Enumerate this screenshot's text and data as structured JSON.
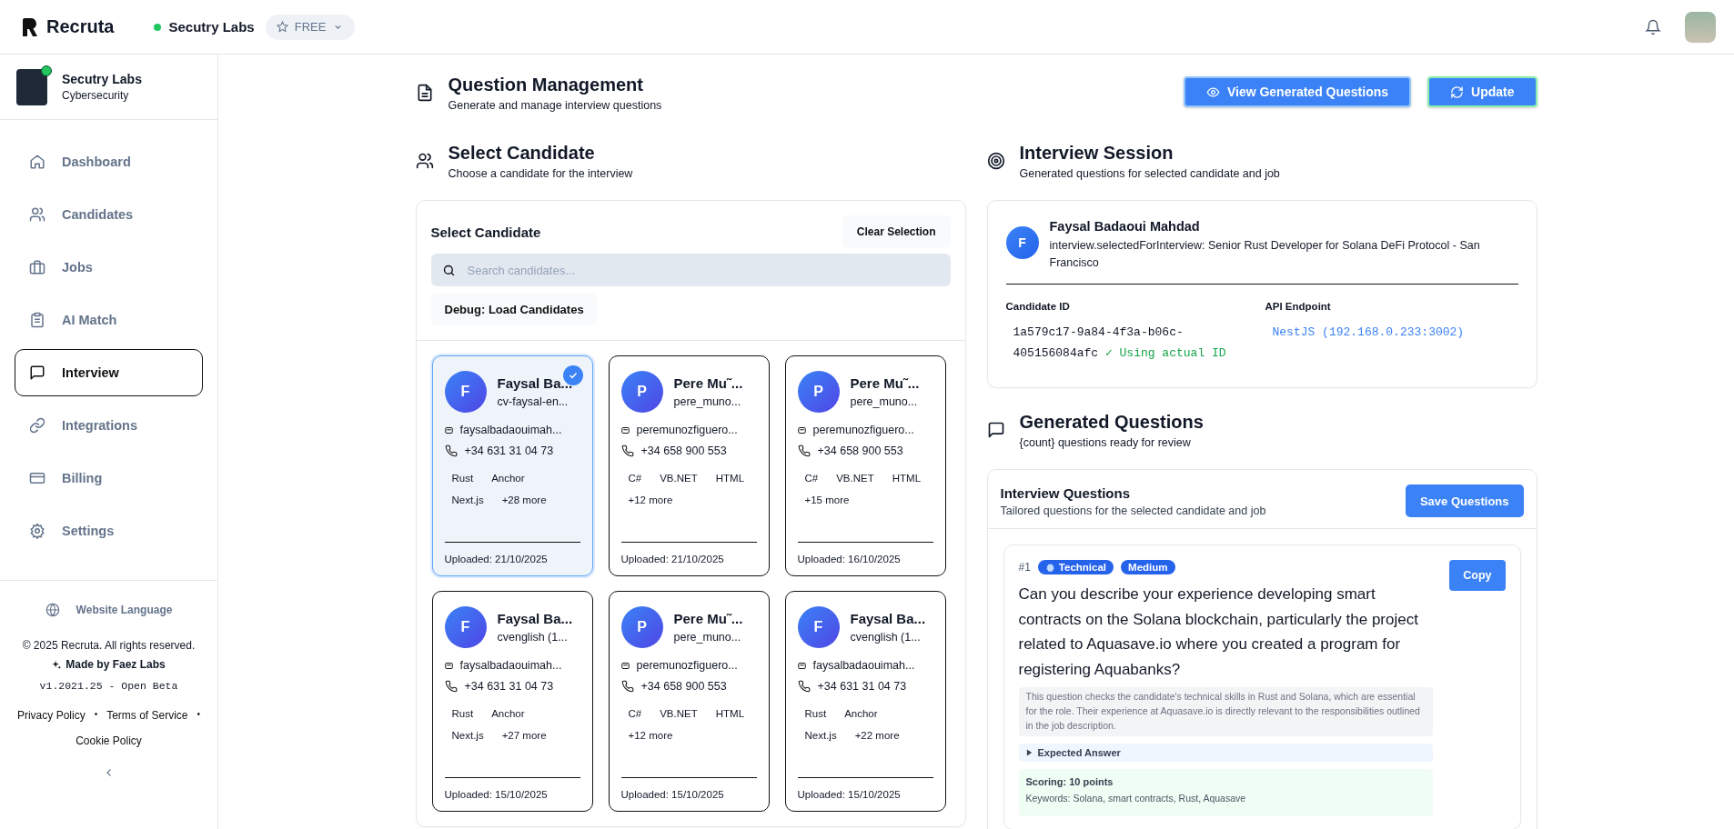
{
  "brand": {
    "name": "Recruta"
  },
  "workspace": {
    "name": "Secutry Labs",
    "online": true
  },
  "plan": {
    "label": "FREE"
  },
  "sidebar": {
    "profile": {
      "name": "Secutry Labs",
      "subtitle": "Cybersecurity",
      "online": true
    },
    "items": [
      {
        "label": "Dashboard",
        "selected": false
      },
      {
        "label": "Candidates",
        "selected": false
      },
      {
        "label": "Jobs",
        "selected": false
      },
      {
        "label": "AI Match",
        "selected": false
      },
      {
        "label": "Interview",
        "selected": true
      },
      {
        "label": "Integrations",
        "selected": false
      },
      {
        "label": "Billing",
        "selected": false
      },
      {
        "label": "Settings",
        "selected": false
      }
    ],
    "footer": {
      "language": "Website Language",
      "copyright": "© 2025 Recruta. All rights reserved.",
      "made_by": "Made by Faez Labs",
      "version": "v1.2021.25 - Open Beta",
      "links": [
        "Privacy Policy",
        "Terms of Service",
        "Cookie Policy"
      ],
      "separators": [
        "•",
        "•"
      ]
    }
  },
  "page": {
    "title": "Question Management",
    "subtitle": "Generate and manage interview questions",
    "buttons": [
      "View Generated Questions",
      "Update"
    ]
  },
  "candidate_section": {
    "title": "Select Candidate",
    "subtitle": "Choose a candidate for the interview",
    "card_title": "Select Candidate",
    "clear_button": "Clear Selection",
    "search": {
      "placeholder": "Search candidates..."
    },
    "debug_button": "Debug: Load Candidates",
    "candidates": [
      {
        "initial": "F",
        "name": "Faysal Ba...",
        "file": "cv-faysal-en...",
        "email": "faysalbadaouimah...",
        "phone": "+34 631 31 04 73",
        "skills": [
          "Rust",
          "Anchor",
          "Next.js",
          "+28 more"
        ],
        "uploaded": "Uploaded: 21/10/2025",
        "selected": true
      },
      {
        "initial": "P",
        "name": "Pere Mu˜...",
        "file": "pere_muno...",
        "email": "peremunozfiguero...",
        "phone": "+34 658 900 553",
        "skills": [
          "C#",
          "VB.NET",
          "HTML",
          "+12 more"
        ],
        "uploaded": "Uploaded: 21/10/2025",
        "selected": false
      },
      {
        "initial": "P",
        "name": "Pere Mu˜...",
        "file": "pere_muno...",
        "email": "peremunozfiguero...",
        "phone": "+34 658 900 553",
        "skills": [
          "C#",
          "VB.NET",
          "HTML",
          "+15 more"
        ],
        "uploaded": "Uploaded: 16/10/2025",
        "selected": false
      },
      {
        "initial": "F",
        "name": "Faysal Ba...",
        "file": "cvenglish (1...",
        "email": "faysalbadaouimah...",
        "phone": "+34 631 31 04 73",
        "skills": [
          "Rust",
          "Anchor",
          "Next.js",
          "+27 more"
        ],
        "uploaded": "Uploaded: 15/10/2025",
        "selected": false
      },
      {
        "initial": "P",
        "name": "Pere Mu˜...",
        "file": "pere_muno...",
        "email": "peremunozfiguero...",
        "phone": "+34 658 900 553",
        "skills": [
          "C#",
          "VB.NET",
          "HTML",
          "+12 more"
        ],
        "uploaded": "Uploaded: 15/10/2025",
        "selected": false
      },
      {
        "initial": "F",
        "name": "Faysal Ba...",
        "file": "cvenglish (1...",
        "email": "faysalbadaouimah...",
        "phone": "+34 631 31 04 73",
        "skills": [
          "Rust",
          "Anchor",
          "Next.js",
          "+22 more"
        ],
        "uploaded": "Uploaded: 15/10/2025",
        "selected": false
      }
    ]
  },
  "session_section": {
    "title": "Interview Session",
    "subtitle": "Generated questions for selected candidate and job",
    "candidate": {
      "initial": "F",
      "name": "Faysal Badaoui Mahdad",
      "role": "interview.selectedForInterview: Senior Rust Developer for Solana DeFi Protocol - San Francisco"
    },
    "id_label": "Candidate ID",
    "id_value": "1a579c17-9a84-4f3a-b06c-405156084afc",
    "id_note": "✓ Using actual ID",
    "api_label": "API Endpoint",
    "api_value": "NestJS (192.168.0.233:3002)"
  },
  "questions_section": {
    "title": "Generated Questions",
    "subtitle": "{count} questions ready for review",
    "card_title": "Interview Questions",
    "card_subtitle": "Tailored questions for the selected candidate and job",
    "save_button": "Save Questions",
    "questions": [
      {
        "number": "#1",
        "tags": [
          {
            "kind": "category",
            "label": "Technical"
          },
          {
            "kind": "difficulty",
            "label": "Medium"
          }
        ],
        "text": "Can you describe your experience developing smart contracts on the Solana blockchain, particularly the project related to Aquasave.io where you created a program for registering Aquabanks?",
        "rationale": "This question checks the candidate's technical skills in Rust and Solana, which are essential for the role. Their experience at Aquasave.io is directly relevant to the responsibilities outlined in the job description.",
        "expected": "Expected Answer",
        "expanded": false,
        "scoring": "Scoring: 10 points",
        "keywords": "Keywords: Solana, smart contracts, Rust, Aquasave",
        "copy_button": "Copy"
      }
    ]
  }
}
